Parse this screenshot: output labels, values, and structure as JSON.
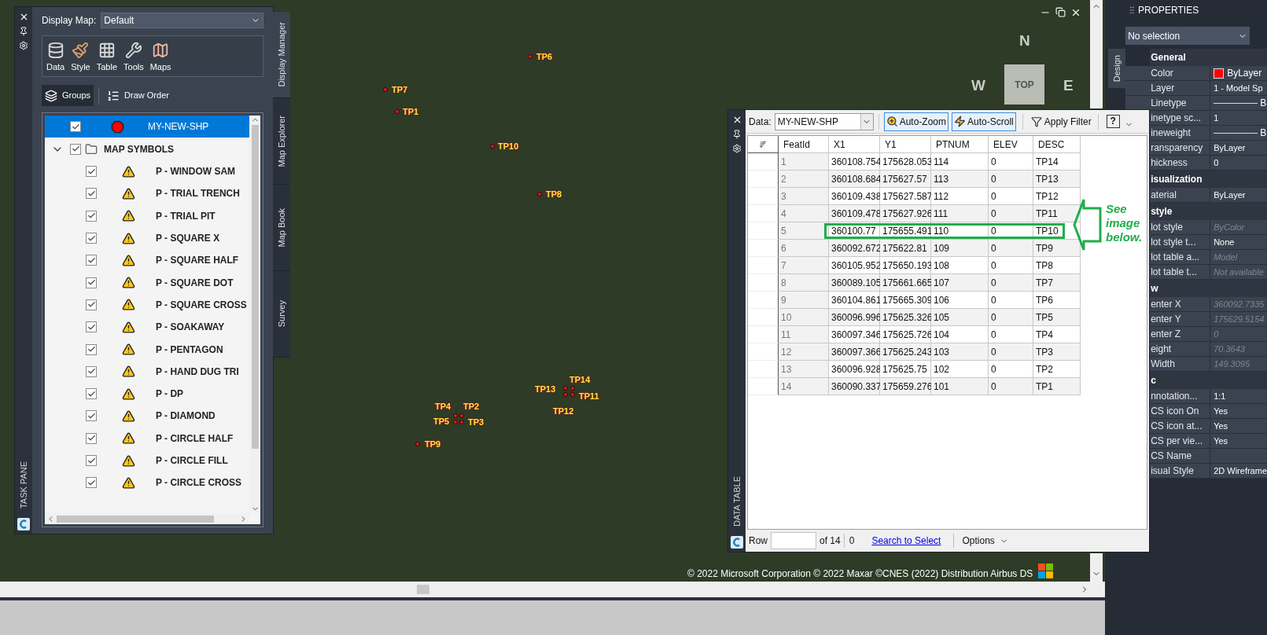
{
  "map": {
    "markers": [
      {
        "label": "TP6"
      },
      {
        "label": "TP7"
      },
      {
        "label": "TP1"
      },
      {
        "label": "TP10"
      },
      {
        "label": "TP8"
      },
      {
        "label": "TP14"
      },
      {
        "label": "TP13"
      },
      {
        "label": "TP11"
      },
      {
        "label": "TP4"
      },
      {
        "label": "TP2"
      },
      {
        "label": "TP12"
      },
      {
        "label": "TP5"
      },
      {
        "label": "TP3"
      },
      {
        "label": "TP9"
      }
    ],
    "viewcube": {
      "north": "N",
      "west": "W",
      "top": "TOP",
      "east": "E"
    },
    "attribution": "© 2022 Microsoft Corporation © 2022 Maxar ©CNES (2022) Distribution Airbus DS"
  },
  "task_pane": {
    "title": "TASK PANE",
    "display_map": {
      "label": "Display Map:",
      "value": "Default"
    },
    "tools": [
      {
        "kind": "data",
        "label": "Data"
      },
      {
        "kind": "style",
        "label": "Style"
      },
      {
        "kind": "table",
        "label": "Table"
      },
      {
        "kind": "tools",
        "label": "Tools"
      },
      {
        "kind": "maps",
        "label": "Maps"
      }
    ],
    "view_buttons": [
      {
        "kind": "groups",
        "label": "Groups",
        "selected": true
      },
      {
        "kind": "draw_order",
        "label": "Draw Order",
        "selected": false
      }
    ],
    "layers": [
      {
        "kind": "layer",
        "label": "MY-NEW-SHP",
        "checked": true,
        "selected": true
      },
      {
        "kind": "group",
        "label": "MAP SYMBOLS",
        "checked": true,
        "selected": false,
        "expanded": true,
        "children": [
          {
            "label": "P - WINDOW SAM",
            "checked": true,
            "selected": false
          },
          {
            "label": "P - TRIAL TRENCH",
            "checked": true,
            "selected": false
          },
          {
            "label": "P - TRIAL PIT",
            "checked": true,
            "selected": false
          },
          {
            "label": "P - SQUARE X",
            "checked": true,
            "selected": false
          },
          {
            "label": "P - SQUARE HALF",
            "checked": true,
            "selected": false
          },
          {
            "label": "P - SQUARE DOT",
            "checked": true,
            "selected": false
          },
          {
            "label": "P - SQUARE CROSS",
            "checked": true,
            "selected": false
          },
          {
            "label": "P - SOAKAWAY",
            "checked": true,
            "selected": false
          },
          {
            "label": "P - PENTAGON",
            "checked": true,
            "selected": false
          },
          {
            "label": "P - HAND DUG TRI",
            "checked": true,
            "selected": false
          },
          {
            "label": "P - DP",
            "checked": true,
            "selected": false
          },
          {
            "label": "P - DIAMOND",
            "checked": true,
            "selected": false
          },
          {
            "label": "P - CIRCLE HALF",
            "checked": true,
            "selected": false
          },
          {
            "label": "P - CIRCLE FILL",
            "checked": true,
            "selected": false
          },
          {
            "label": "P - CIRCLE CROSS",
            "checked": true,
            "selected": false
          }
        ]
      }
    ],
    "side_tabs": [
      {
        "label": "Display Manager",
        "selected": true
      },
      {
        "label": "Map Explorer",
        "selected": false
      },
      {
        "label": "Map Book",
        "selected": false
      },
      {
        "label": "Survey",
        "selected": false
      }
    ]
  },
  "data_table": {
    "title": "DATA TABLE",
    "data_label": "Data:",
    "data_value": "MY-NEW-SHP",
    "toggles": [
      {
        "kind": "zoom",
        "label": "Auto-Zoom",
        "on": true
      },
      {
        "kind": "scroll",
        "label": "Auto-Scroll",
        "on": true
      }
    ],
    "filter_button": "Apply Filter",
    "help_button": "?",
    "columns": [
      "FeatId",
      "X1",
      "Y1",
      "PTNUM",
      "ELEV",
      "DESC"
    ],
    "rows": [
      {
        "cells": [
          "1",
          "360108.754",
          "175628.053",
          "114",
          "0",
          "TP14"
        ],
        "callout": false
      },
      {
        "cells": [
          "2",
          "360108.684",
          "175627.57",
          "113",
          "0",
          "TP13"
        ],
        "callout": false
      },
      {
        "cells": [
          "3",
          "360109.438",
          "175627.587",
          "112",
          "0",
          "TP12"
        ],
        "callout": false
      },
      {
        "cells": [
          "4",
          "360109.478",
          "175627.926",
          "111",
          "0",
          "TP11"
        ],
        "callout": false
      },
      {
        "cells": [
          "5",
          "360100.77",
          "175655.491",
          "110",
          "0",
          "TP10"
        ],
        "callout": true
      },
      {
        "cells": [
          "6",
          "360092.672",
          "175622.81",
          "109",
          "0",
          "TP9"
        ],
        "callout": false
      },
      {
        "cells": [
          "7",
          "360105.952",
          "175650.193",
          "108",
          "0",
          "TP8"
        ],
        "callout": false
      },
      {
        "cells": [
          "8",
          "360089.105",
          "175661.665",
          "107",
          "0",
          "TP7"
        ],
        "callout": false
      },
      {
        "cells": [
          "9",
          "360104.861",
          "175665.309",
          "106",
          "0",
          "TP6"
        ],
        "callout": false
      },
      {
        "cells": [
          "10",
          "360096.996",
          "175625.326",
          "105",
          "0",
          "TP5"
        ],
        "callout": false
      },
      {
        "cells": [
          "11",
          "360097.346",
          "175625.726",
          "104",
          "0",
          "TP4"
        ],
        "callout": false
      },
      {
        "cells": [
          "12",
          "360097.366",
          "175625.243",
          "103",
          "0",
          "TP3"
        ],
        "callout": false
      },
      {
        "cells": [
          "13",
          "360096.928",
          "175625.75",
          "102",
          "0",
          "TP2"
        ],
        "callout": false
      },
      {
        "cells": [
          "14",
          "360090.337",
          "175659.276",
          "101",
          "0",
          "TP1"
        ],
        "callout": false
      }
    ],
    "callout_note": "See image below.",
    "footer": {
      "row_label": "Row",
      "of_count": "of 14",
      "count": "0",
      "link": "Search to Select",
      "options": "Options"
    }
  },
  "properties": {
    "title": "PROPERTIES",
    "side_tab": "Design",
    "selection": "No selection",
    "sections": [
      {
        "title": "General",
        "rows": [
          {
            "label": "Color",
            "value": "ByLayer",
            "kind": "color",
            "color": "#ff0000",
            "disabled": false
          },
          {
            "label": "Layer",
            "value": "1 - Model Sp",
            "kind": "text",
            "disabled": false
          },
          {
            "label": "Linetype",
            "value": "B",
            "kind": "line",
            "disabled": false
          },
          {
            "label": "inetype sc...",
            "value": "1",
            "kind": "text",
            "disabled": false
          },
          {
            "label": "ineweight",
            "value": "B",
            "kind": "line",
            "disabled": false
          },
          {
            "label": "ransparency",
            "value": "ByLayer",
            "kind": "text",
            "disabled": false
          },
          {
            "label": "hickness",
            "value": "0",
            "kind": "text",
            "disabled": false
          }
        ]
      },
      {
        "title": "isualization",
        "rows": [
          {
            "label": "aterial",
            "value": "ByLayer",
            "kind": "text",
            "disabled": false
          }
        ]
      },
      {
        "title": "style",
        "rows": [
          {
            "label": "lot style",
            "value": "ByColor",
            "kind": "text",
            "disabled": true
          },
          {
            "label": "lot style t...",
            "value": "None",
            "kind": "text",
            "disabled": false
          },
          {
            "label": "lot table a...",
            "value": "Model",
            "kind": "text",
            "disabled": true
          },
          {
            "label": "lot table t...",
            "value": "Not available",
            "kind": "text",
            "disabled": true
          }
        ]
      },
      {
        "title": "w",
        "rows": [
          {
            "label": "enter X",
            "value": "360092.7335",
            "kind": "text",
            "disabled": true
          },
          {
            "label": "enter Y",
            "value": "175629.5154",
            "kind": "text",
            "disabled": true
          },
          {
            "label": "enter Z",
            "value": "0",
            "kind": "text",
            "disabled": true
          },
          {
            "label": "eight",
            "value": "70.3643",
            "kind": "text",
            "disabled": true
          },
          {
            "label": "Width",
            "value": "149.3095",
            "kind": "text",
            "disabled": true
          }
        ]
      },
      {
        "title": "c",
        "rows": [
          {
            "label": "nnotation...",
            "value": "1:1",
            "kind": "text",
            "disabled": false
          },
          {
            "label": "CS icon On",
            "value": "Yes",
            "kind": "text",
            "disabled": false
          },
          {
            "label": "CS icon at...",
            "value": "Yes",
            "kind": "text",
            "disabled": false
          },
          {
            "label": "CS per vie...",
            "value": "Yes",
            "kind": "text",
            "disabled": false
          },
          {
            "label": "CS Name",
            "kind": "text"
          },
          {
            "label": "isual Style",
            "value": "2D Wireframe",
            "kind": "text",
            "disabled": false
          }
        ]
      }
    ]
  }
}
